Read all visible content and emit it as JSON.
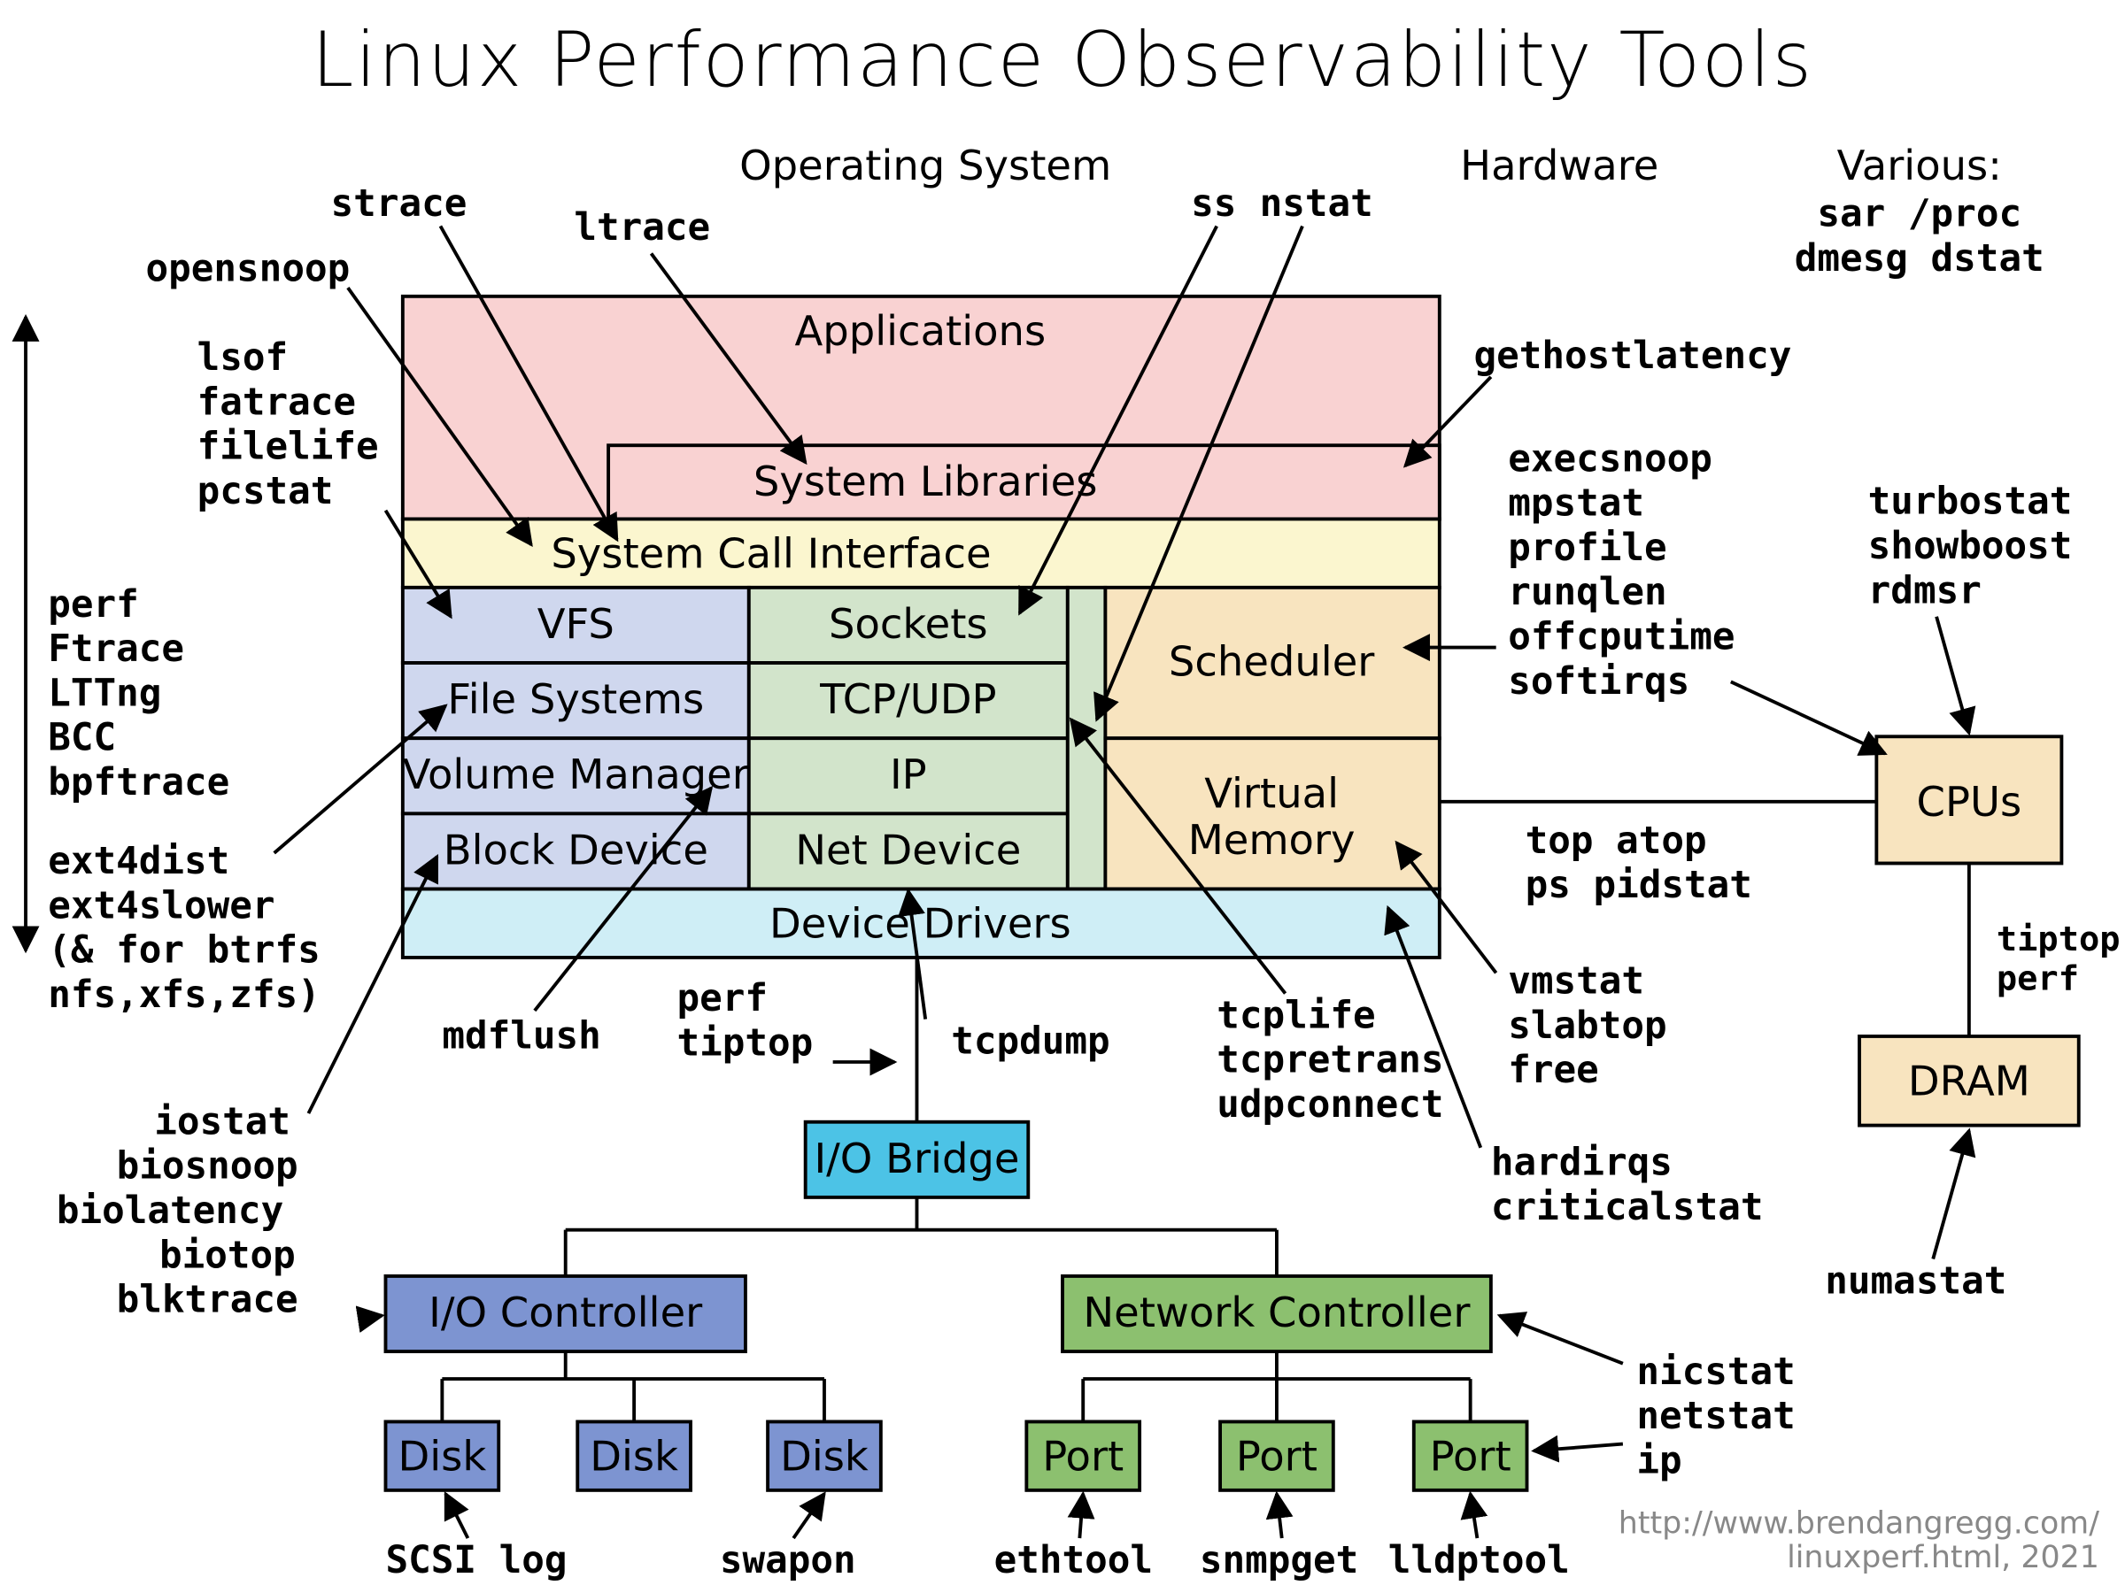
{
  "title": "Linux Performance Observability Tools",
  "sections": {
    "os": "Operating System",
    "hw": "Hardware",
    "various_hdr": "Various:"
  },
  "various": [
    "sar /proc",
    "dmesg dstat"
  ],
  "boxes": {
    "applications": "Applications",
    "syslibs": "System Libraries",
    "syscall": "System Call Interface",
    "vfs": "VFS",
    "sockets": "Sockets",
    "fs": "File Systems",
    "tcpudp": "TCP/UDP",
    "volmgr": "Volume Manager",
    "ip": "IP",
    "blockdev": "Block Device",
    "netdev": "Net Device",
    "scheduler": "Scheduler",
    "vmem_l1": "Virtual",
    "vmem_l2": "Memory",
    "drivers": "Device Drivers",
    "iobridge": "I/O Bridge",
    "ioctrl": "I/O Controller",
    "netctrl": "Network Controller",
    "disk": "Disk",
    "port": "Port",
    "cpus": "CPUs",
    "dram": "DRAM"
  },
  "tools": {
    "strace": "strace",
    "ltrace": "ltrace",
    "ss": "ss",
    "nstat": "nstat",
    "opensnoop": "opensnoop",
    "lsof": "lsof",
    "fatrace": "fatrace",
    "filelife": "filelife",
    "pcstat": "pcstat",
    "perf": "perf",
    "ftrace": "Ftrace",
    "lttng": "LTTng",
    "bcc": "BCC",
    "bpftrace": "bpftrace",
    "ext4dist": "ext4dist",
    "ext4slower": "ext4slower",
    "ext4note1": "(& for btrfs",
    "ext4note2": "nfs,xfs,zfs)",
    "iostat": "iostat",
    "biosnoop": "biosnoop",
    "biolatency": "biolatency",
    "biotop": "biotop",
    "blktrace": "blktrace",
    "mdflush": "mdflush",
    "perf2": "perf",
    "tiptop2": "tiptop",
    "tcpdump": "tcpdump",
    "tcplife": "tcplife",
    "tcpretrans": "tcpretrans",
    "udpconnect": "udpconnect",
    "gethostlatency": "gethostlatency",
    "execsnoop": "execsnoop",
    "mpstat": "mpstat",
    "profile": "profile",
    "runqlen": "runqlen",
    "offcputime": "offcputime",
    "softirqs": "softirqs",
    "top_atop": "top atop",
    "ps_pidstat": "ps pidstat",
    "vmstat": "vmstat",
    "slabtop": "slabtop",
    "free": "free",
    "hardirqs": "hardirqs",
    "criticalstat": "criticalstat",
    "turbostat": "turbostat",
    "showboost": "showboost",
    "rdmsr": "rdmsr",
    "tiptop3": "tiptop",
    "perf3": "perf",
    "numastat": "numastat",
    "nicstat": "nicstat",
    "netstat": "netstat",
    "ip_tool": "ip",
    "swapon": "swapon",
    "ethtool": "ethtool",
    "snmpget": "snmpget",
    "lldptool": "lldptool",
    "scsilog": "SCSI log"
  },
  "footer": {
    "l1": "http://www.brendangregg.com/",
    "l2": "linuxperf.html, 2021"
  }
}
